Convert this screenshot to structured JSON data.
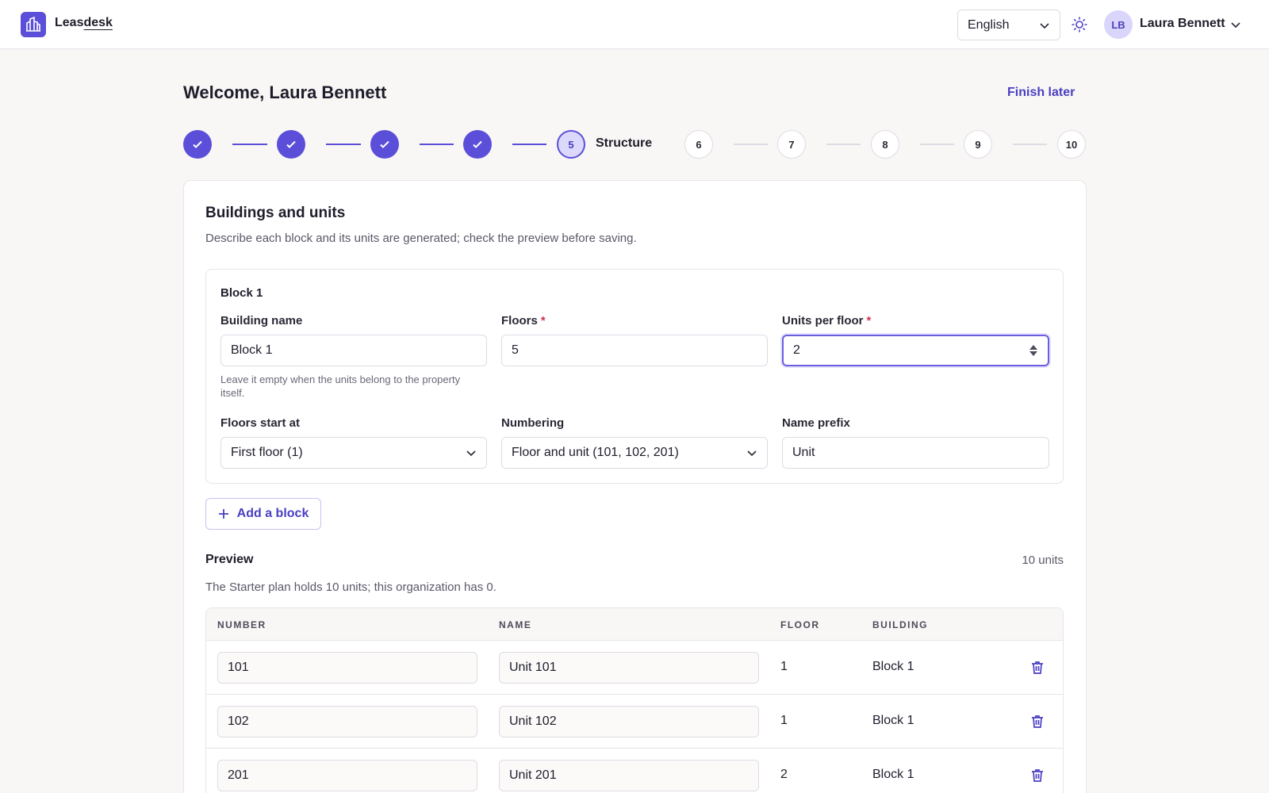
{
  "header": {
    "brand_prefix": "Leas",
    "brand_suffix": "desk",
    "language": "English",
    "user_initials": "LB",
    "user_name": "Laura Bennett"
  },
  "page": {
    "welcome": "Welcome, Laura Bennett",
    "finish_later": "Finish later"
  },
  "stepper": {
    "current_number": "5",
    "current_label": "Structure",
    "upcoming": [
      "6",
      "7",
      "8",
      "9",
      "10"
    ]
  },
  "section": {
    "title": "Buildings and units",
    "description": "Describe each block and its units are generated; check the preview before saving."
  },
  "block": {
    "title": "Block 1",
    "building_name_label": "Building name",
    "building_name_value": "Block 1",
    "building_name_hint": "Leave it empty when the units belong to the property itself.",
    "floors_label": "Floors",
    "floors_value": "5",
    "units_per_floor_label": "Units per floor",
    "units_per_floor_value": "2",
    "required_mark": "*",
    "floors_start_label": "Floors start at",
    "floors_start_value": "First floor (1)",
    "numbering_label": "Numbering",
    "numbering_value": "Floor and unit (101, 102, 201)",
    "name_prefix_label": "Name prefix",
    "name_prefix_value": "Unit"
  },
  "add_block_label": "Add a block",
  "preview": {
    "title": "Preview",
    "count": "10 units",
    "description": "The Starter plan holds 10 units; this organization has 0.",
    "columns": [
      "NUMBER",
      "NAME",
      "FLOOR",
      "BUILDING"
    ],
    "rows": [
      {
        "number": "101",
        "name": "Unit 101",
        "floor": "1",
        "building": "Block 1"
      },
      {
        "number": "102",
        "name": "Unit 102",
        "floor": "1",
        "building": "Block 1"
      },
      {
        "number": "201",
        "name": "Unit 201",
        "floor": "2",
        "building": "Block 1"
      }
    ]
  },
  "colors": {
    "accent": "#5b4fd9",
    "accent_text": "#4a3fc2",
    "required": "#d2334e",
    "background": "#f8f7f5"
  },
  "icons": {
    "brand": "building-icon",
    "language": "chevron-down-icon",
    "theme": "sun-icon",
    "user_menu": "chevron-down-icon",
    "completed_step": "check-icon",
    "select": "chevron-down-icon",
    "spinner": "stepper-arrows-icon",
    "add": "plus-icon",
    "delete": "trash-icon"
  }
}
